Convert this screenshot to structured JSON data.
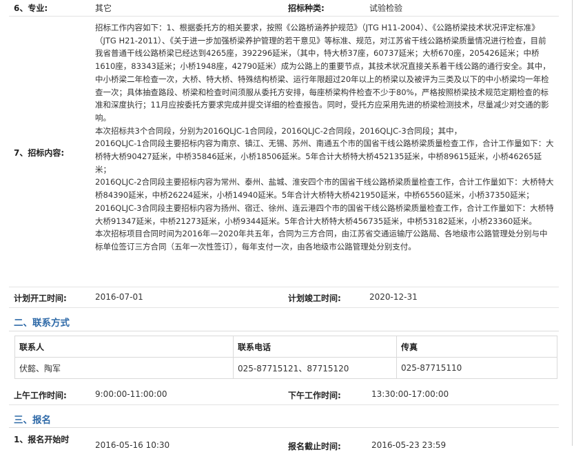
{
  "row6": {
    "label": "6、专业:",
    "value": "其它",
    "label2": "招标种类:",
    "value2": "试验检验"
  },
  "row7": {
    "label": "7、招标内容:",
    "paragraphs": [
      "招标工作内容如下：1、根据委托方的相关要求，按照《公路桥涵养护规范》（JTG H11-2004）、《公路桥梁技术状况评定标准》（JTG H21-2011）、《关于进一步加强桥梁养护管理的若干意见》等标准、规范，对江苏省干线公路桥梁质量情况进行检查，目前我省普通干线公路桥梁已经达到4265座，392296延米，（其中，特大桥37座，60737延米；大桥670座，205426延米；中桥1610座，83343延米；小桥1948座，42790延米）成为公路上的重要节点，其技术状况直接关系着干线公路的通行安全。其中，中小桥梁二年检查一次，大桥、特大桥、特殊结构桥梁、运行年限超过20年以上的桥梁以及被评为三类及以下的中小桥梁均一年检查一次；具体抽查路段、桥梁和检查时间须服从委托方安排，每座桥梁构件检查不少于80%，严格按照桥梁技术规范定期检查的标准和深度执行；11月应按委托方要求完成并提交详细的检查报告。同时，受托方应采用先进的桥梁检测技术，尽量减少对交通的影响。",
      "本次招标共3个合同段，分别为2016QLJC-1合同段，2016QLJC-2合同段，2016QLJC-3合同段；其中，",
      "2016QLJC-1合同段主要招标内容为南京、镇江、无锡、苏州、南通五个市的国省干线公路桥梁质量检查工作，合计工作量如下：大桥特大桥90427延米，中桥35846延米，小桥18506延米。5年合计大桥特大桥452135延米，中桥89615延米，小桥46265延米；",
      "2016QLJC-2合同段主要招标内容为常州、泰州、盐城、淮安四个市的国省干线公路桥梁质量检查工作，合计工作量如下：大桥特大桥84390延米，中桥26224延米，小桥14940延米。5年合计大桥特大桥421950延米，中桥65560延米，小桥37350延米；",
      "2016QLJC-3合同段主要招标内容为扬州、宿迁、徐州、连云港四个市的国省干线公路桥梁质量检查工作，合计工作量如下：大桥特大桥91347延米，中桥21273延米，小桥9344延米。5年合计大桥特大桥456735延米，中桥53182延米，小桥23360延米。",
      "本次招标项目合同时间为2016年—2020年共五年，合同为三方合同，由江苏省交通运输厅公路局、各地级市公路管理处分别与中标单位签订三方合同（五年一次性签订），每年支付一次，由各地级市公路管理处分别支付。"
    ]
  },
  "schedule": {
    "start_label": "计划开工时间:",
    "start_value": "2016-07-01",
    "end_label": "计划竣工时间:",
    "end_value": "2020-12-31"
  },
  "contact_section": {
    "title": "二、联系方式"
  },
  "contact_table": {
    "headers": [
      "联系人",
      "联系电话",
      "传真"
    ],
    "row": [
      "伏懿、陶军",
      "025-87715121、87715120",
      "025-87715110"
    ]
  },
  "hours": {
    "am_label": "上午工作时间:",
    "am_value": "9:00:00-11:00:00",
    "pm_label": "下午工作时间:",
    "pm_value": "13:30:00-17:00:00"
  },
  "signup_section": {
    "title": "三、报名"
  },
  "signup": {
    "start_label": "1、报名开始时",
    "start_value": "2016-05-16 10:30",
    "end_label": "报名截止时间:",
    "end_value": "2016-05-23 23:59"
  }
}
